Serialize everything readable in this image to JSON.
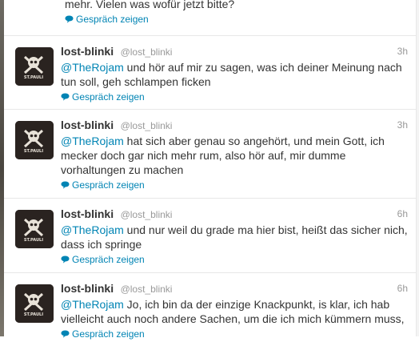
{
  "top_partial": {
    "text": "mehr. Vielen was wofür jetzt bitte?",
    "action": "Gespräch zeigen"
  },
  "tweets": [
    {
      "name": "lost-blinki",
      "handle": "@lost_blinki",
      "time": "3h",
      "mention": "@TheRojam",
      "text": " und hör auf mir zu sagen, was ich deiner Meinung nach tun soll, geh schlampen ficken",
      "action": "Gespräch zeigen"
    },
    {
      "name": "lost-blinki",
      "handle": "@lost_blinki",
      "time": "3h",
      "mention": "@TheRojam",
      "text": " hat sich aber genau so angehört, und mein Gott, ich mecker doch gar nich mehr rum, also hör auf, mir dumme vorhaltungen zu machen",
      "action": "Gespräch zeigen"
    },
    {
      "name": "lost-blinki",
      "handle": "@lost_blinki",
      "time": "6h",
      "mention": "@TheRojam",
      "text": " und nur weil du grade ma hier bist, heißt das sicher nich, dass ich springe",
      "action": "Gespräch zeigen"
    },
    {
      "name": "lost-blinki",
      "handle": "@lost_blinki",
      "time": "6h",
      "mention": "@TheRojam",
      "text": " Jo, ich bin da der einzige Knackpunkt, is klar, ich hab vielleicht auch noch andere Sachen, um die ich mich kümmern muss,",
      "action": "Gespräch zeigen"
    }
  ],
  "avatar_label": "ST.PAULI",
  "colors": {
    "link": "#0084b4",
    "text": "#333333",
    "muted": "#999999",
    "border": "#e8e8e8"
  },
  "icons": {
    "conversation": "speech-bubble-icon",
    "avatar": "skull-crossbones-icon"
  }
}
